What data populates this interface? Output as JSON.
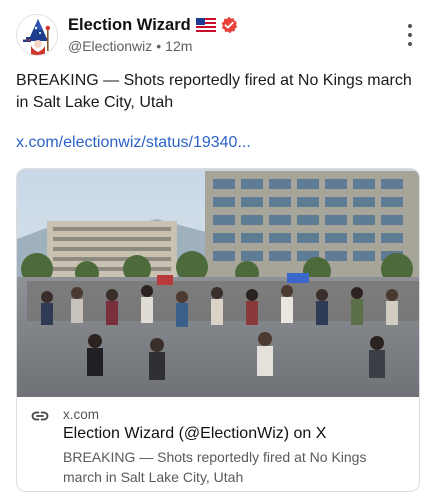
{
  "post": {
    "author_name": "Election Wizard",
    "author_flag_icon": "us-flag-icon",
    "verified_icon": "verified-badge-icon",
    "handle": "@Electionwiz",
    "separator": "•",
    "time": "12m",
    "body": "BREAKING — Shots reportedly fired at No Kings march in Salt Lake City, Utah",
    "link_text": "x.com/electionwiz/status/19340..."
  },
  "card": {
    "domain": "x.com",
    "title": "Election Wizard (@ElectionWiz) on X",
    "description": "BREAKING — Shots reportedly fired at No Kings march in Salt Lake City, Utah"
  },
  "colors": {
    "link": "#2b62c9",
    "verified": "#e8403a",
    "avatar_accent": "#d1342f"
  }
}
